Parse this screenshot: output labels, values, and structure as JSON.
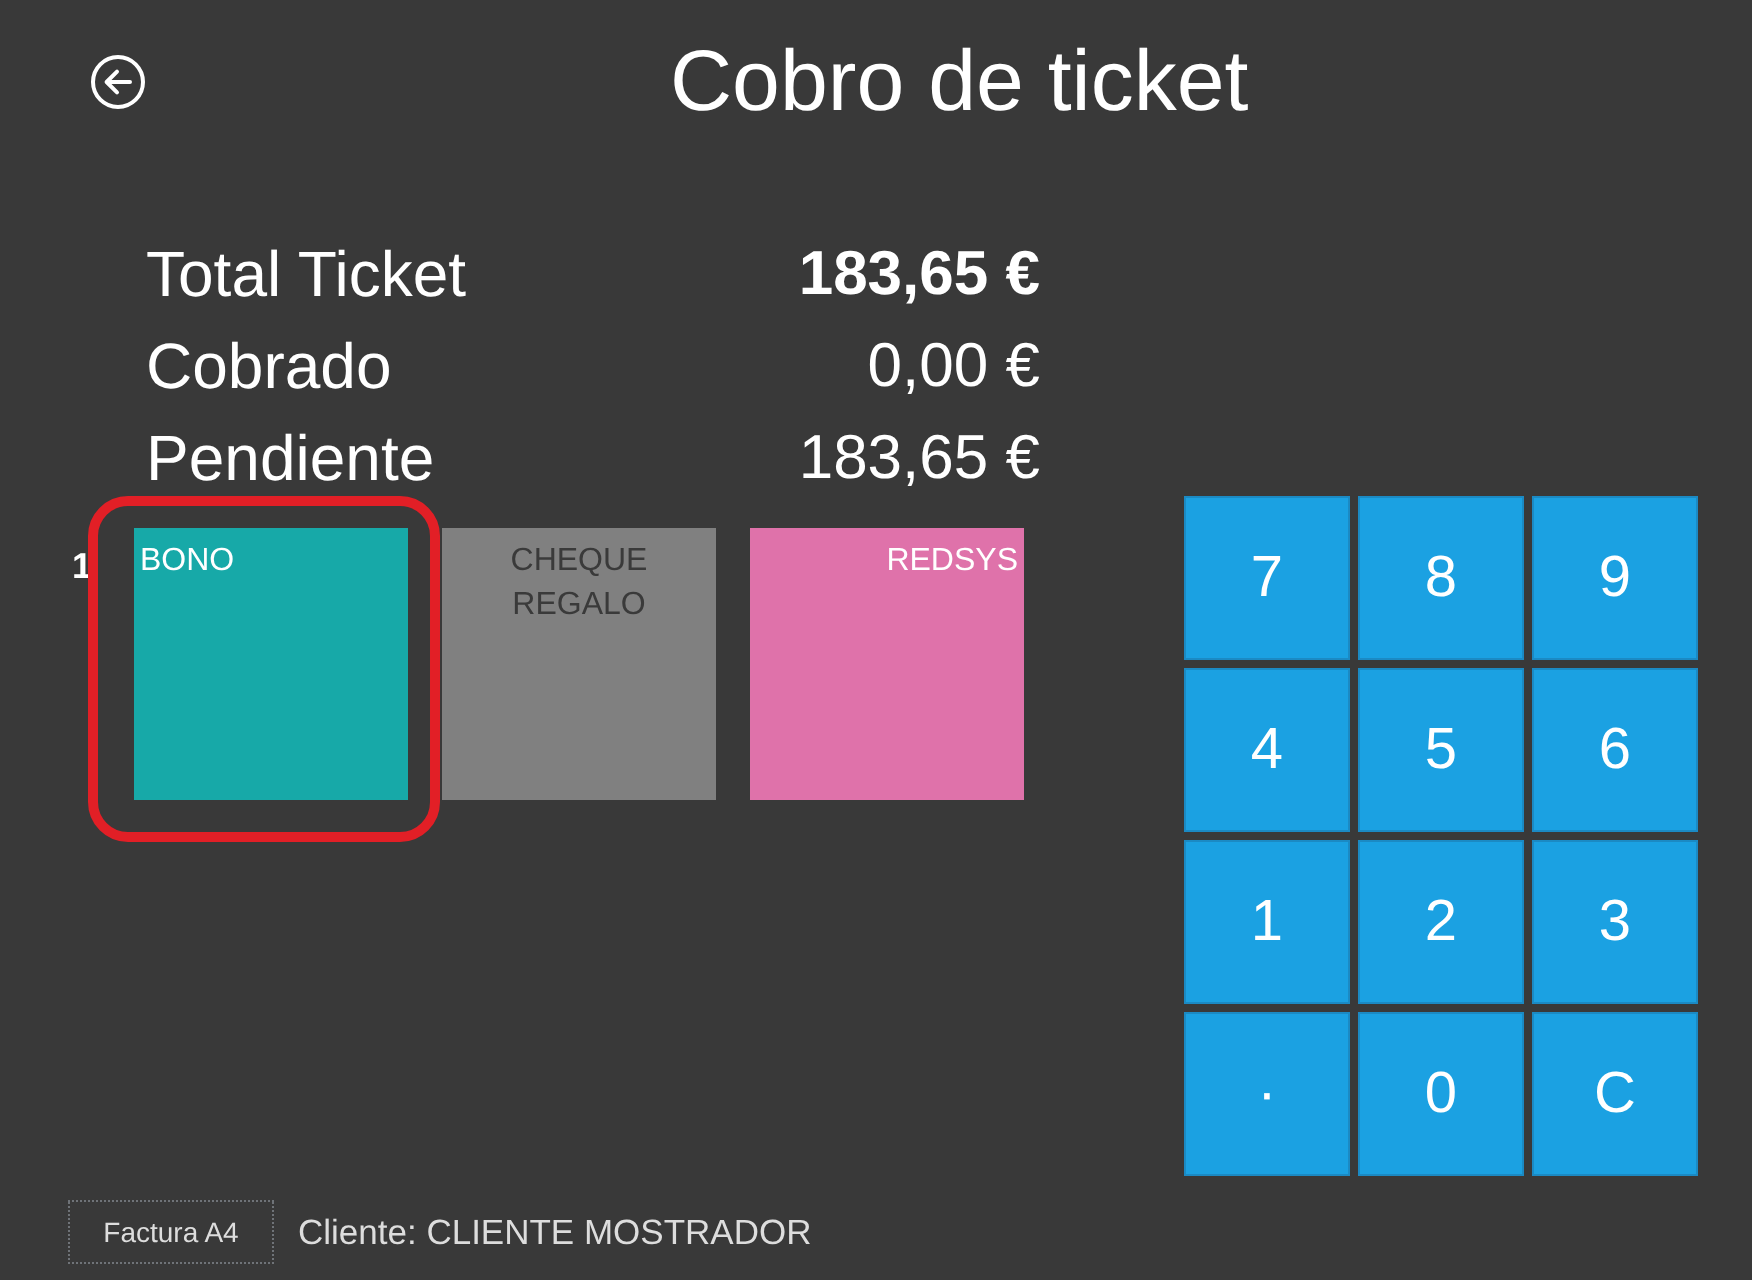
{
  "header": {
    "title": "Cobro de ticket"
  },
  "summary": [
    {
      "label": "Total Ticket",
      "value": "183,65 €",
      "emphasis": true
    },
    {
      "label": "Cobrado",
      "value": "0,00 €",
      "emphasis": false
    },
    {
      "label": "Pendiente",
      "value": "183,65 €",
      "emphasis": false
    }
  ],
  "payment_methods": {
    "index_label": "1",
    "items": [
      {
        "label": "BONO",
        "color": "#17a9a8",
        "kind": "start",
        "dark_label": false,
        "highlighted": true
      },
      {
        "label": "CHEQUE REGALO",
        "color": "#808080",
        "kind": "center",
        "dark_label": true,
        "highlighted": false
      },
      {
        "label": "REDSYS",
        "color": "#df72aa",
        "kind": "end",
        "dark_label": false,
        "highlighted": false
      }
    ]
  },
  "keypad": {
    "keys": [
      "7",
      "8",
      "9",
      "4",
      "5",
      "6",
      "1",
      "2",
      "3",
      "·",
      "0",
      "C"
    ]
  },
  "footer": {
    "button": "Factura A4",
    "client": "Cliente: CLIENTE MOSTRADOR"
  }
}
